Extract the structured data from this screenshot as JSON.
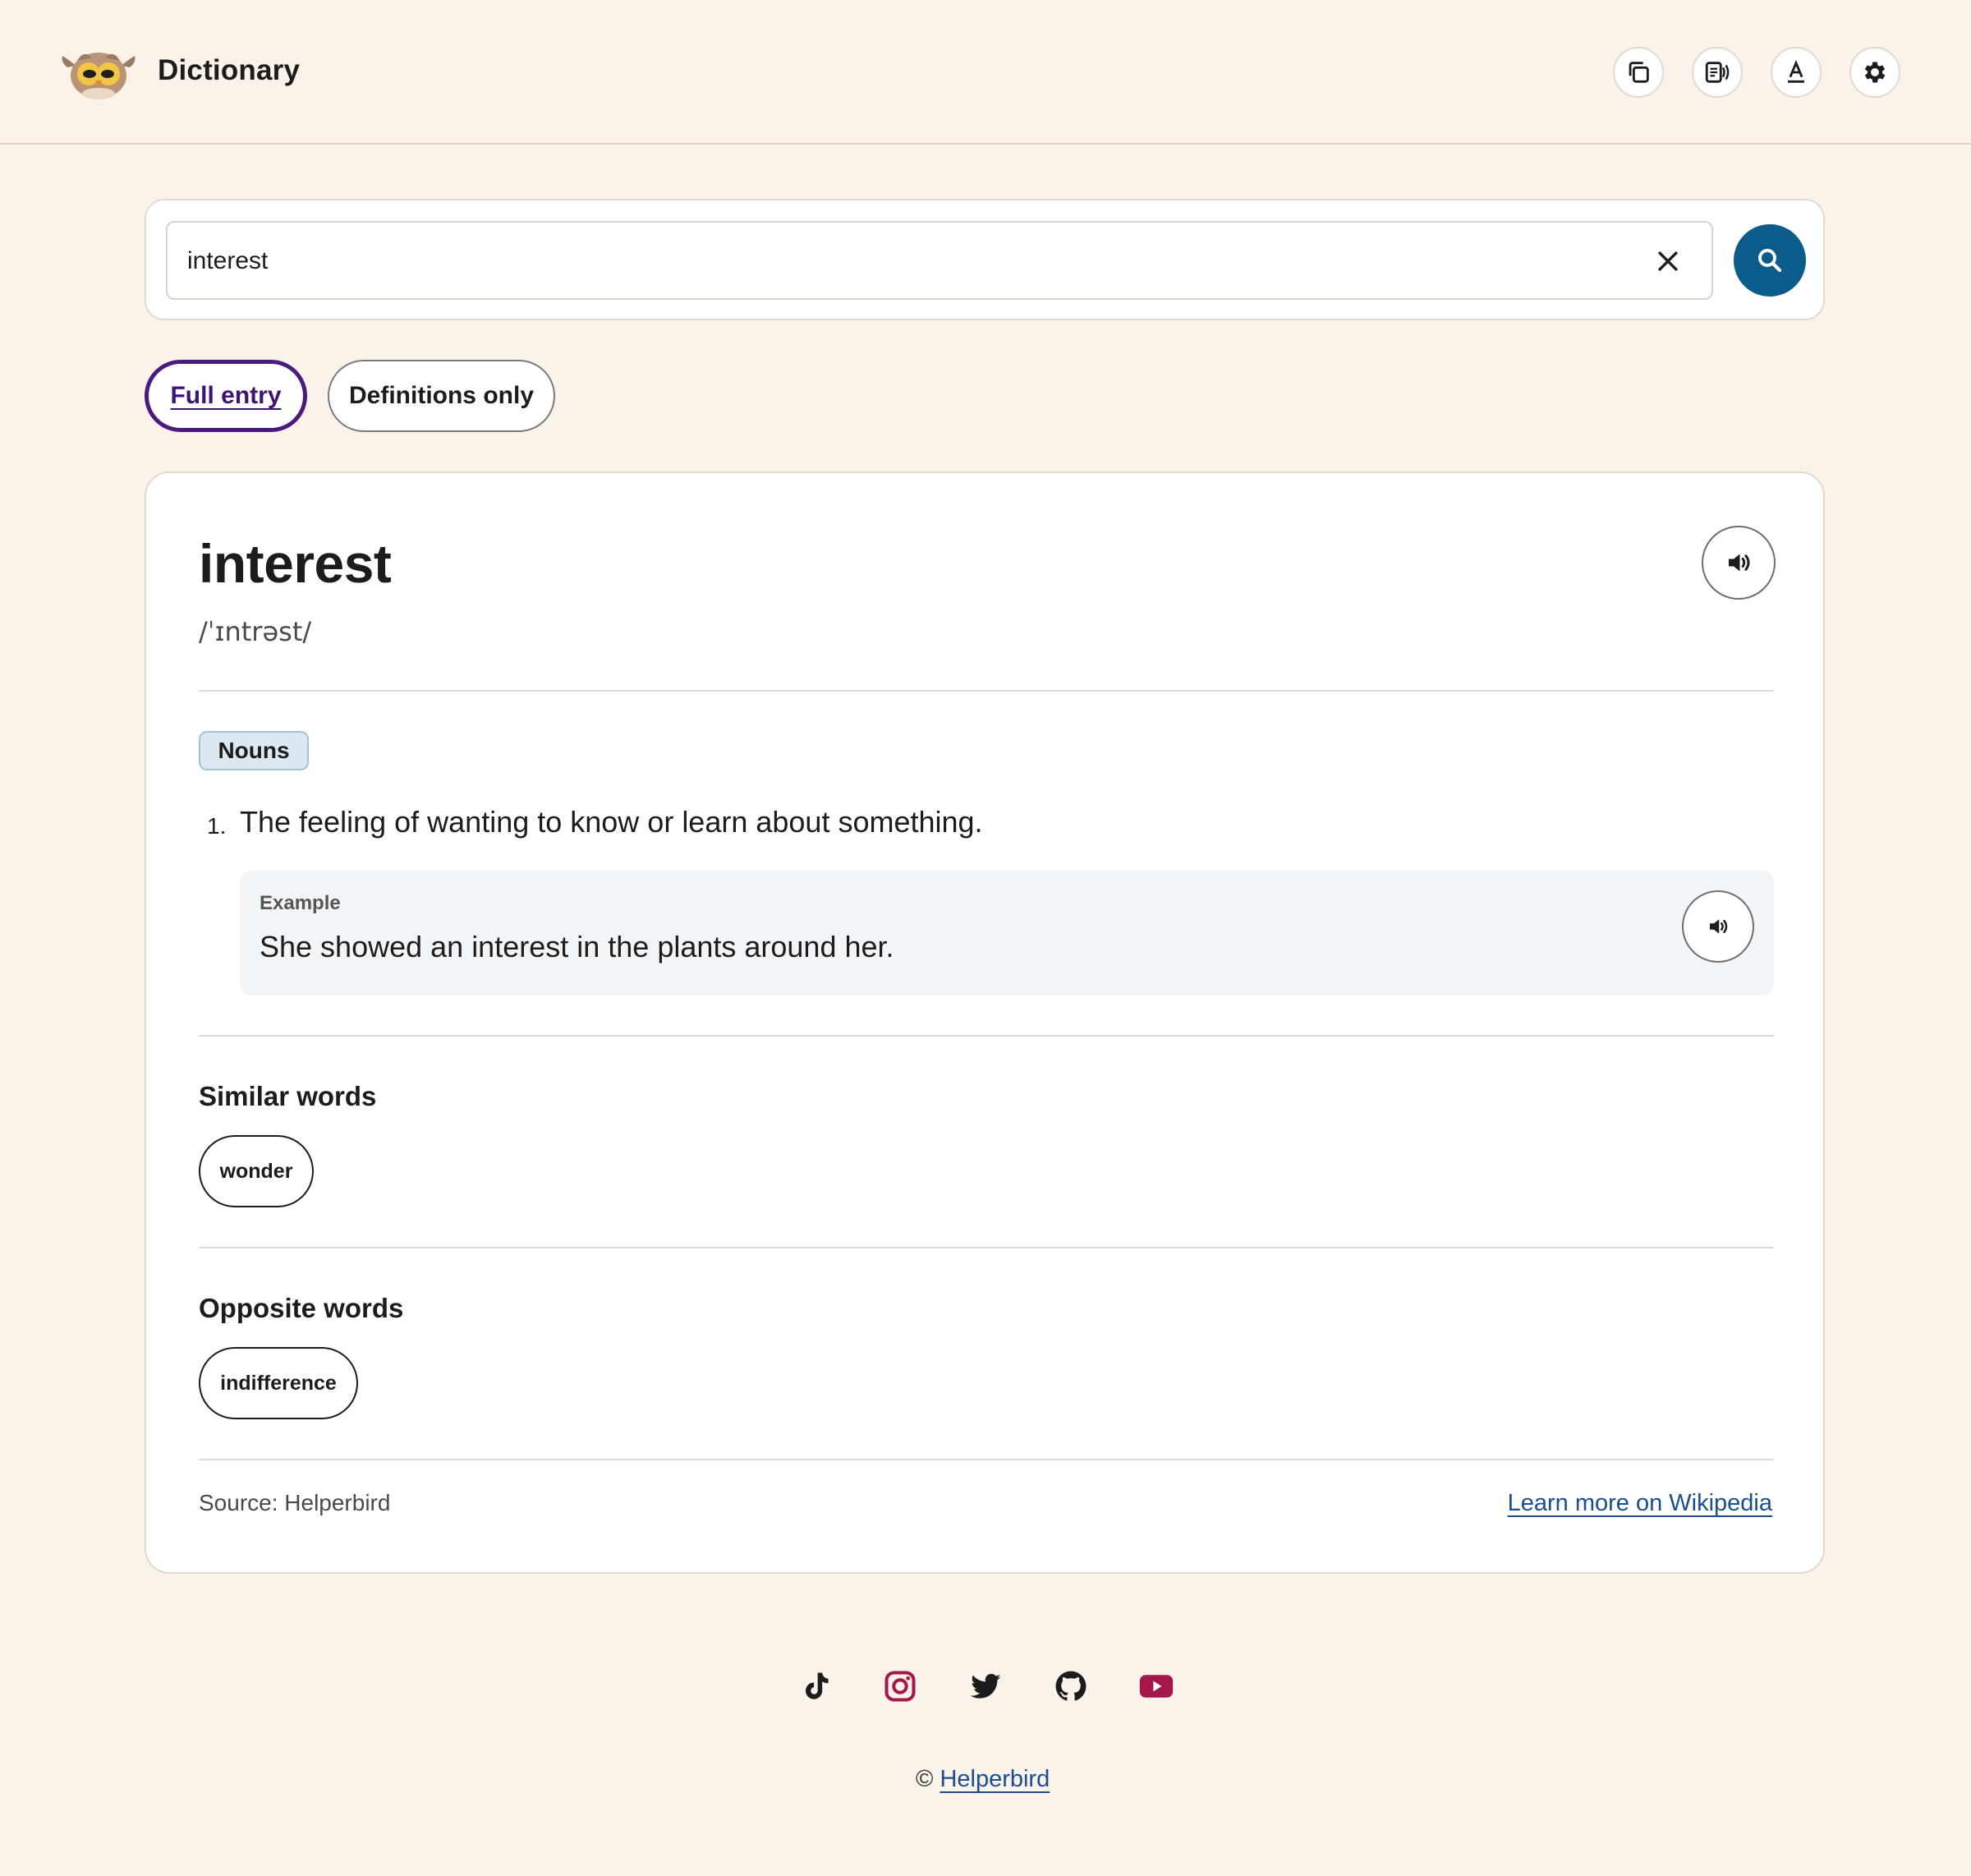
{
  "header": {
    "title": "Dictionary",
    "tools": [
      {
        "name": "copy-icon"
      },
      {
        "name": "read-aloud-icon"
      },
      {
        "name": "text-style-icon"
      },
      {
        "name": "gear-icon"
      }
    ]
  },
  "search": {
    "value": "interest",
    "placeholder": ""
  },
  "tabs": {
    "full_entry": "Full entry",
    "definitions_only": "Definitions only",
    "active": "full_entry"
  },
  "entry": {
    "word": "interest",
    "phonetic": "/ˈɪntrəst/",
    "part_of_speech": "Nouns",
    "definitions": [
      {
        "number": "1.",
        "text": "The feeling of wanting to know or learn about something.",
        "example_label": "Example",
        "example": "She showed an interest in the plants around her."
      }
    ],
    "similar_title": "Similar words",
    "similar": [
      "wonder"
    ],
    "opposite_title": "Opposite words",
    "opposite": [
      "indifference"
    ],
    "source": "Source: Helperbird",
    "wiki_link": "Learn more on Wikipedia"
  },
  "footer": {
    "social": [
      "tiktok-icon",
      "instagram-icon",
      "twitter-icon",
      "github-icon",
      "youtube-icon"
    ],
    "copyright_symbol": "©",
    "copyright_link": "Helperbird"
  },
  "colors": {
    "background": "#fbf2ea",
    "accent_blue": "#0b5c8a",
    "active_tab": "#4b1a7e",
    "link": "#1a4e8c",
    "instagram": "#a3174a",
    "youtube": "#a3174a"
  }
}
